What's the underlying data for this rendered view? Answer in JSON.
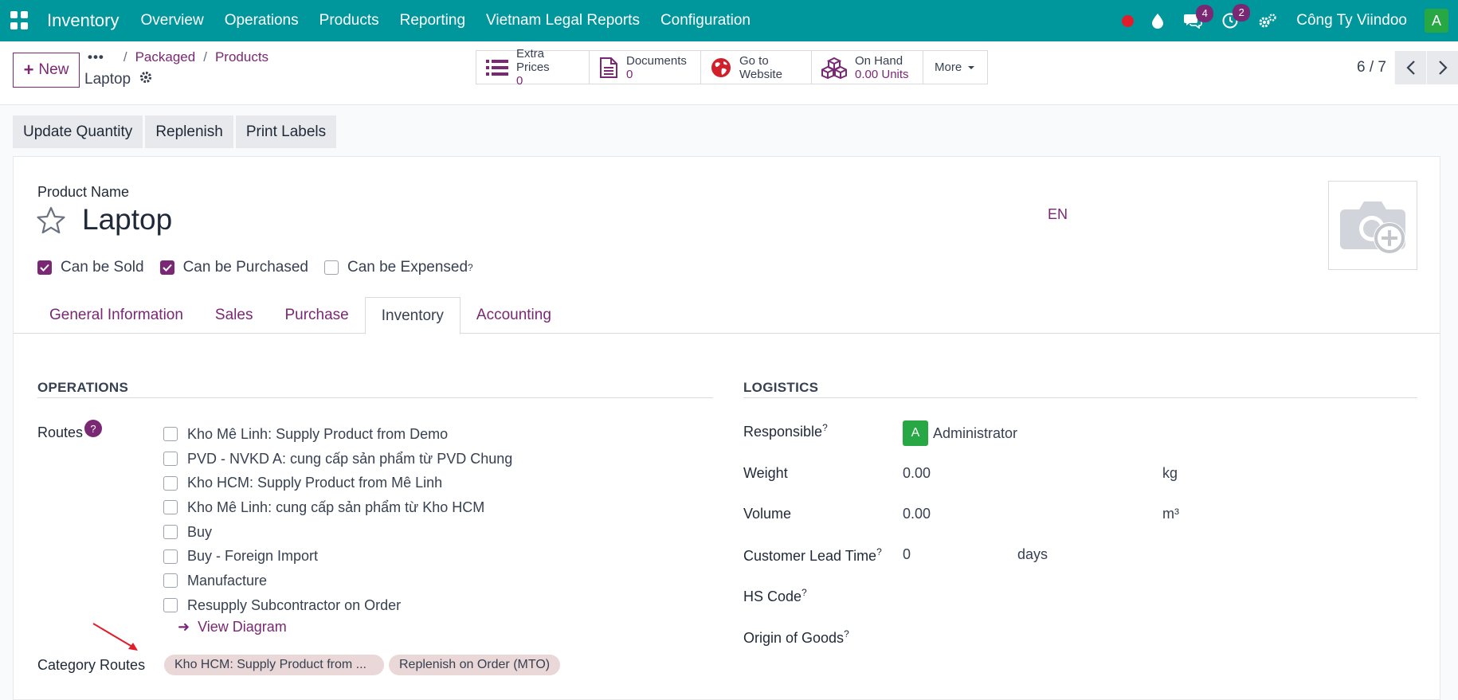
{
  "navbar": {
    "app_name": "Inventory",
    "menu": [
      "Overview",
      "Operations",
      "Products",
      "Reporting",
      "Vietnam Legal Reports",
      "Configuration"
    ],
    "messages_count": "4",
    "activities_count": "2",
    "company": "Công Ty Viindoo",
    "avatar_initial": "A"
  },
  "control": {
    "new_label": "New",
    "breadcrumb": [
      "Packaged",
      "Products"
    ],
    "record_name": "Laptop",
    "smart_buttons": {
      "extra_prices": {
        "label": "Extra Prices",
        "value": "0"
      },
      "documents": {
        "label": "Documents",
        "value": "0"
      },
      "website": {
        "line1": "Go to",
        "line2": "Website"
      },
      "on_hand": {
        "label": "On Hand",
        "value": "0.00 Units"
      },
      "more": "More"
    },
    "pager": "6 / 7"
  },
  "actions": [
    "Update Quantity",
    "Replenish",
    "Print Labels"
  ],
  "form": {
    "product_name_label": "Product Name",
    "product_name": "Laptop",
    "lang": "EN",
    "checks": {
      "can_be_sold": {
        "label": "Can be Sold",
        "checked": true
      },
      "can_be_purchased": {
        "label": "Can be Purchased",
        "checked": true
      },
      "can_be_expensed": {
        "label": "Can be Expensed",
        "checked": false
      }
    },
    "tabs": [
      "General Information",
      "Sales",
      "Purchase",
      "Inventory",
      "Accounting"
    ],
    "active_tab": "Inventory",
    "operations": {
      "title": "OPERATIONS",
      "routes_label": "Routes",
      "routes_help": "?",
      "routes": [
        "Kho Mê Linh: Supply Product from Demo",
        "PVD - NVKD A: cung cấp sản phẩm từ PVD Chung",
        "Kho HCM: Supply Product from Mê Linh",
        "Kho Mê Linh: cung cấp sản phẩm từ Kho HCM",
        "Buy",
        "Buy - Foreign Import",
        "Manufacture",
        "Resupply Subcontractor on Order"
      ],
      "view_diagram": "View Diagram",
      "category_routes_label": "Category Routes",
      "category_routes": [
        "Kho HCM: Supply Product from ...",
        "Replenish on Order (MTO)"
      ]
    },
    "logistics": {
      "title": "LOGISTICS",
      "responsible_label": "Responsible",
      "responsible_initial": "A",
      "responsible": "Administrator",
      "weight_label": "Weight",
      "weight": "0.00",
      "weight_unit": "kg",
      "volume_label": "Volume",
      "volume": "0.00",
      "volume_unit": "m³",
      "lead_time_label": "Customer Lead Time",
      "lead_time": "0",
      "lead_time_unit": "days",
      "hs_code_label": "HS Code",
      "origin_label": "Origin of Goods"
    }
  },
  "colors": {
    "primary": "#00979c",
    "accent": "#7a2874",
    "avatar": "#27a844"
  }
}
